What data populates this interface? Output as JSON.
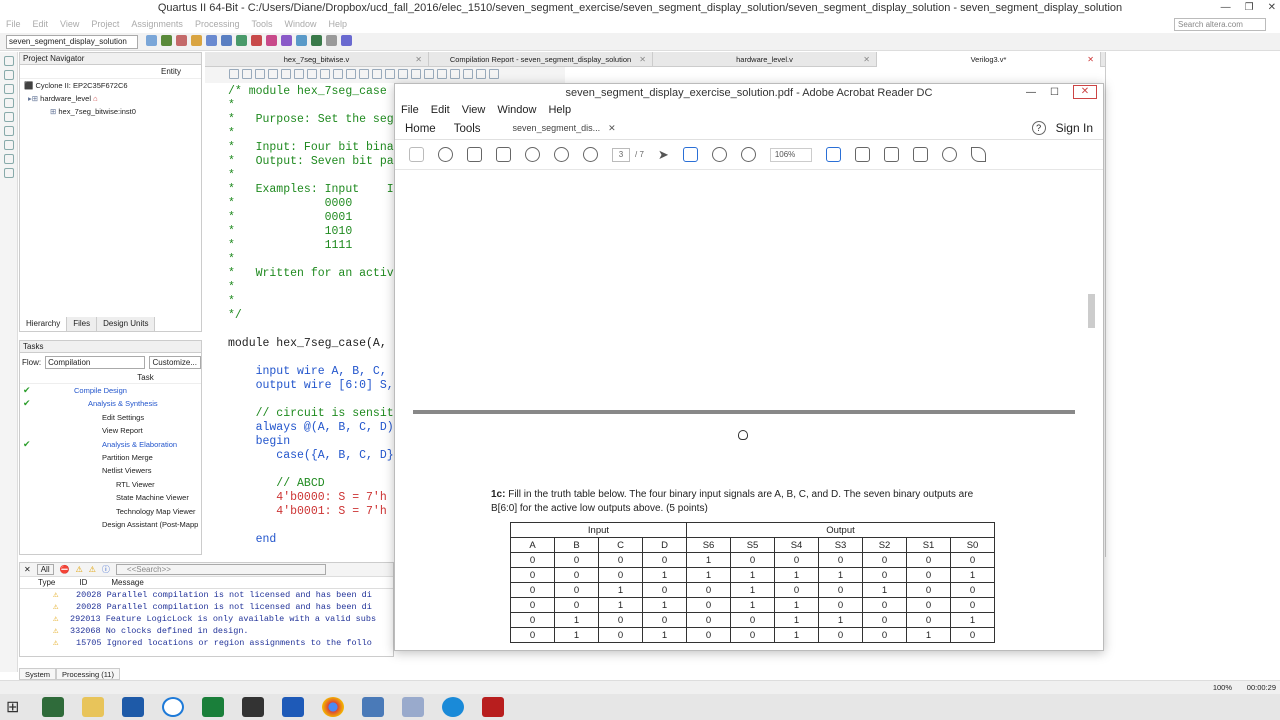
{
  "window": {
    "title": "Quartus II 64-Bit - C:/Users/Diane/Dropbox/ucd_fall_2016/elec_1510/seven_segment_exercise/seven_segment_display_solution/seven_segment_display_solution - seven_segment_display_solution",
    "menu": [
      "File",
      "Edit",
      "View",
      "Project",
      "Assignments",
      "Processing",
      "Tools",
      "Window",
      "Help"
    ],
    "search_placeholder": "Search altera.com",
    "entity_combo": "seven_segment_display_solution"
  },
  "navigator": {
    "title": "Project Navigator",
    "col": "Entity",
    "device": "Cyclone II: EP2C35F672C6",
    "top": "hardware_level",
    "inst": "hex_7seg_bitwise:inst0",
    "tabs": [
      "Hierarchy",
      "Files",
      "Design Units"
    ]
  },
  "tasks": {
    "title": "Tasks",
    "flow_label": "Flow:",
    "flow_value": "Compilation",
    "customize": "Customize...",
    "col": "Task",
    "items": [
      "Compile Design",
      "Analysis & Synthesis",
      "Edit Settings",
      "View Report",
      "Analysis & Elaboration",
      "Partition Merge",
      "Netlist Viewers",
      "RTL Viewer",
      "State Machine Viewer",
      "Technology Map Viewer",
      "Design Assistant (Post-Mapp"
    ]
  },
  "editor_tabs": [
    "hex_7seg_bitwise.v",
    "Compilation Report - seven_segment_display_solution",
    "hardware_level.v",
    "Verilog3.v*"
  ],
  "code": {
    "l1": "/* module hex_7seg_case",
    "l2": "*",
    "l3": "*   Purpose: Set the seg",
    "l4": "*",
    "l5": "*   Input: Four bit bina",
    "l6": "*   Output: Seven bit pa",
    "l7": "*",
    "l8": "*   Examples: Input    I",
    "l9": "*             0000",
    "l10": "*             0001",
    "l11": "*             1010",
    "l12": "*             1111",
    "l13": "*",
    "l14": "*   Written for an activ",
    "l15": "*",
    "l16": "*",
    "l17": "*/",
    "l18": "",
    "l19": "module hex_7seg_case(A,",
    "l20": "",
    "l21": "    input wire A, B, C,",
    "l22": "    output wire [6:0] S,",
    "l23": "",
    "l24": "    // circuit is sensit",
    "l25": "    always @(A, B, C, D)",
    "l26": "    begin",
    "l27": "       case({A, B, C, D}",
    "l28": "",
    "l29": "       // ABCD",
    "l30": "       4'b0000: S = 7'h",
    "l31": "       4'b0001: S = 7'h",
    "l32": "",
    "l33": "    end"
  },
  "messages": {
    "filter_all": "All",
    "search_placeholder": "<<Search>>",
    "cols": [
      "Type",
      "ID",
      "Message"
    ],
    "rows": [
      "20028 Parallel compilation is not licensed and has been di",
      "20028 Parallel compilation is not licensed and has been di",
      "292013 Feature LogicLock is only available with a valid subs",
      "332068 No clocks defined in design.",
      "15705 Ignored locations or region assignments to the follo"
    ],
    "tabs": [
      "System",
      "Processing (11)"
    ]
  },
  "status": {
    "zoom": "100%",
    "time": "00:00:29"
  },
  "acrobat": {
    "title": "seven_segment_display_exercise_solution.pdf - Adobe Acrobat Reader DC",
    "menu": [
      "File",
      "Edit",
      "View",
      "Window",
      "Help"
    ],
    "home": "Home",
    "tools": "Tools",
    "doc_tab": "seven_segment_dis...",
    "sign_in": "Sign In",
    "page": "3",
    "page_total": "/ 7",
    "zoom": "106%",
    "question": "1c: Fill in the truth table below. The four binary input signals are A, B, C, and D.  The seven binary outputs are B[6:0] for the active low outputs above. (5 points)",
    "question_bold": "1c:",
    "question_text": " Fill in the truth table below. The four binary input signals are A, B, C, and D.  The seven binary outputs are B[6:0] for the active low outputs above. (5 points)",
    "group_input": "Input",
    "group_output": "Output",
    "headers": [
      "A",
      "B",
      "C",
      "D",
      "S6",
      "S5",
      "S4",
      "S3",
      "S2",
      "S1",
      "S0"
    ],
    "rows": [
      [
        "0",
        "0",
        "0",
        "0",
        "1",
        "0",
        "0",
        "0",
        "0",
        "0",
        "0"
      ],
      [
        "0",
        "0",
        "0",
        "1",
        "1",
        "1",
        "1",
        "1",
        "0",
        "0",
        "1"
      ],
      [
        "0",
        "0",
        "1",
        "0",
        "0",
        "1",
        "0",
        "0",
        "1",
        "0",
        "0"
      ],
      [
        "0",
        "0",
        "1",
        "1",
        "0",
        "1",
        "1",
        "0",
        "0",
        "0",
        "0"
      ],
      [
        "0",
        "1",
        "0",
        "0",
        "0",
        "0",
        "1",
        "1",
        "0",
        "0",
        "1"
      ],
      [
        "0",
        "1",
        "0",
        "1",
        "0",
        "0",
        "1",
        "0",
        "0",
        "1",
        "0"
      ]
    ]
  }
}
